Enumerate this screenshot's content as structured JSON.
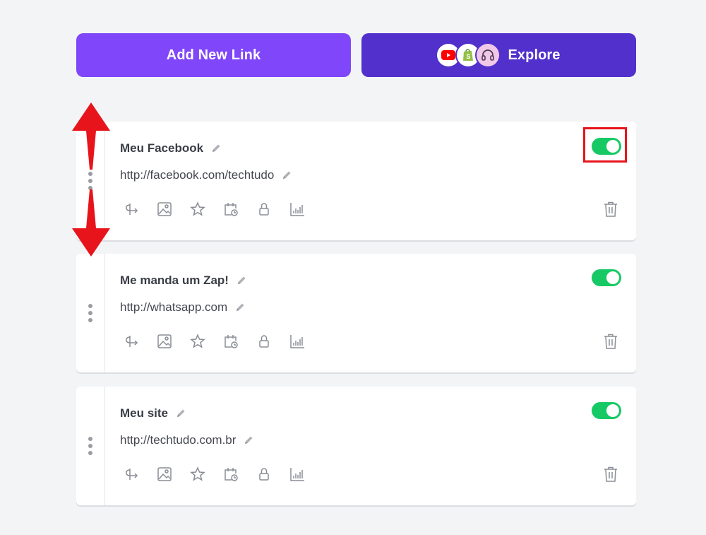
{
  "buttons": {
    "add_new_link": "Add New Link",
    "explore": "Explore",
    "explore_icons": [
      "youtube-icon",
      "shopify-icon",
      "headset-icon"
    ]
  },
  "colors": {
    "add_button": "#8046fa",
    "explore_button": "#5130cc",
    "toggle_on": "#17c964",
    "annotation_red": "#e8141b"
  },
  "links": [
    {
      "title": "Meu Facebook",
      "url": "http://facebook.com/techtudo",
      "enabled": true
    },
    {
      "title": "Me manda um Zap!",
      "url": "http://whatsapp.com",
      "enabled": true
    },
    {
      "title": "Meu site",
      "url": "http://techtudo.com.br",
      "enabled": true
    }
  ],
  "link_tools": [
    "redirect-icon",
    "thumbnail-icon",
    "star-icon",
    "schedule-icon",
    "lock-icon",
    "analytics-icon"
  ],
  "annotations": [
    "toggle-highlight-box",
    "drag-arrows"
  ]
}
